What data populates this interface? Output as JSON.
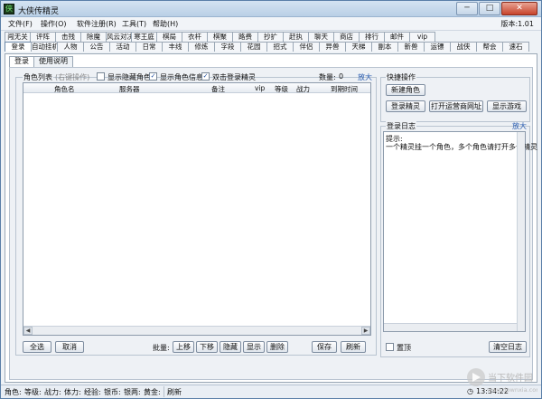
{
  "window": {
    "title": "大侠传精灵",
    "controls": {
      "minimize": "─",
      "maximize": "□",
      "close": "✕"
    }
  },
  "menu": {
    "items": [
      "文件(F)",
      "操作(O)",
      "软件注册(R)",
      "工具(T)",
      "帮助(H)"
    ],
    "version": "版本:1.01"
  },
  "tabs_row1": [
    "闯无关",
    "评阵",
    "击残",
    "除魔",
    "风云对决",
    "寒王庭",
    "棋局",
    "衣杆",
    "棋聚",
    "路费",
    "抄扩",
    "赶执",
    "聊天",
    "商店",
    "排行",
    "邮件",
    "vip"
  ],
  "tabs_row2": [
    "登录",
    "自动挂机",
    "人物",
    "公告",
    "活动",
    "日常",
    "丰线",
    "修炼",
    "字段",
    "花园",
    "招式",
    "伴侣",
    "异兽",
    "天梯",
    "副本",
    "新兽",
    "运镖",
    "战侠",
    "帮会",
    "速石"
  ],
  "subtabs": [
    "登录",
    "使用说明"
  ],
  "role_list": {
    "label": "角色列表",
    "hint": "(右键操作)",
    "option_hide": "显示隐藏角色",
    "option_info": "显示角色信息",
    "option_dblclick": "双击登录精灵",
    "count_label": "数量:",
    "count_value": "0",
    "zoom": "放大",
    "columns": [
      "角色名",
      "服务器",
      "备注",
      "vip",
      "等级",
      "战力",
      "到期时间"
    ]
  },
  "quick_ops": {
    "label": "快捷操作",
    "new_role": "新建角色",
    "login": "登录精灵",
    "open_site": "打开运营商网址",
    "show_game": "显示游戏"
  },
  "log": {
    "label": "登录日志",
    "zoom": "放大",
    "line1": "提示:",
    "line2": "一个精灵挂一个角色，多个角色请打开多个精灵"
  },
  "bottom": {
    "select_all": "全选",
    "cancel": "取消",
    "batch_label": "批量:",
    "move_up": "上移",
    "move_down": "下移",
    "hide": "隐藏",
    "show": "显示",
    "delete": "删除",
    "save": "保存",
    "refresh": "刷新",
    "topmost": "置顶",
    "clear_log": "清空日志"
  },
  "status": {
    "role": "角色:",
    "level": "等级:",
    "power": "战力:",
    "stamina": "体力:",
    "exp": "经验:",
    "coins": "银币:",
    "silver": "银两:",
    "gold": "黄金:",
    "refresh": "刷新",
    "time": "13:34:22"
  },
  "watermark": {
    "line1": "当下软件园",
    "line2": "www.downxia.com"
  },
  "colors": {
    "link": "#2a5db0",
    "accent": "#5a7fa8"
  }
}
